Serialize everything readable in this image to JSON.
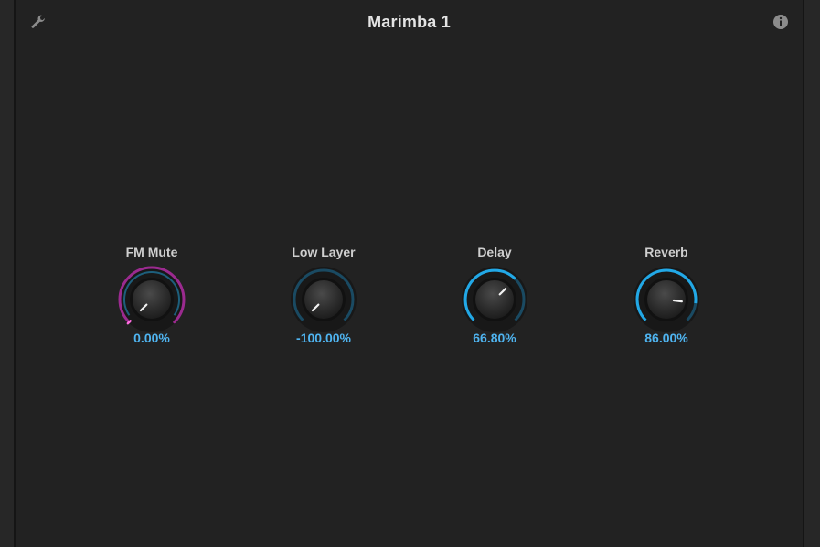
{
  "header": {
    "title": "Marimba 1",
    "settings_icon": "wrench-icon",
    "info_icon": "info-icon"
  },
  "colors": {
    "accent_blue": "#22a8e6",
    "accent_magenta": "#9b2a8f",
    "value_text": "#4fb4f0"
  },
  "knobs": [
    {
      "label": "FM Mute",
      "value_text": "0.00%",
      "value": 0.0,
      "min": 0,
      "max": 100,
      "style": "magenta"
    },
    {
      "label": "Low Layer",
      "value_text": "-100.00%",
      "value": -100.0,
      "min": -100,
      "max": 100,
      "style": "blue"
    },
    {
      "label": "Delay",
      "value_text": "66.80%",
      "value": 66.8,
      "min": 0,
      "max": 100,
      "style": "blue"
    },
    {
      "label": "Reverb",
      "value_text": "86.00%",
      "value": 86.0,
      "min": 0,
      "max": 100,
      "style": "blue"
    }
  ]
}
